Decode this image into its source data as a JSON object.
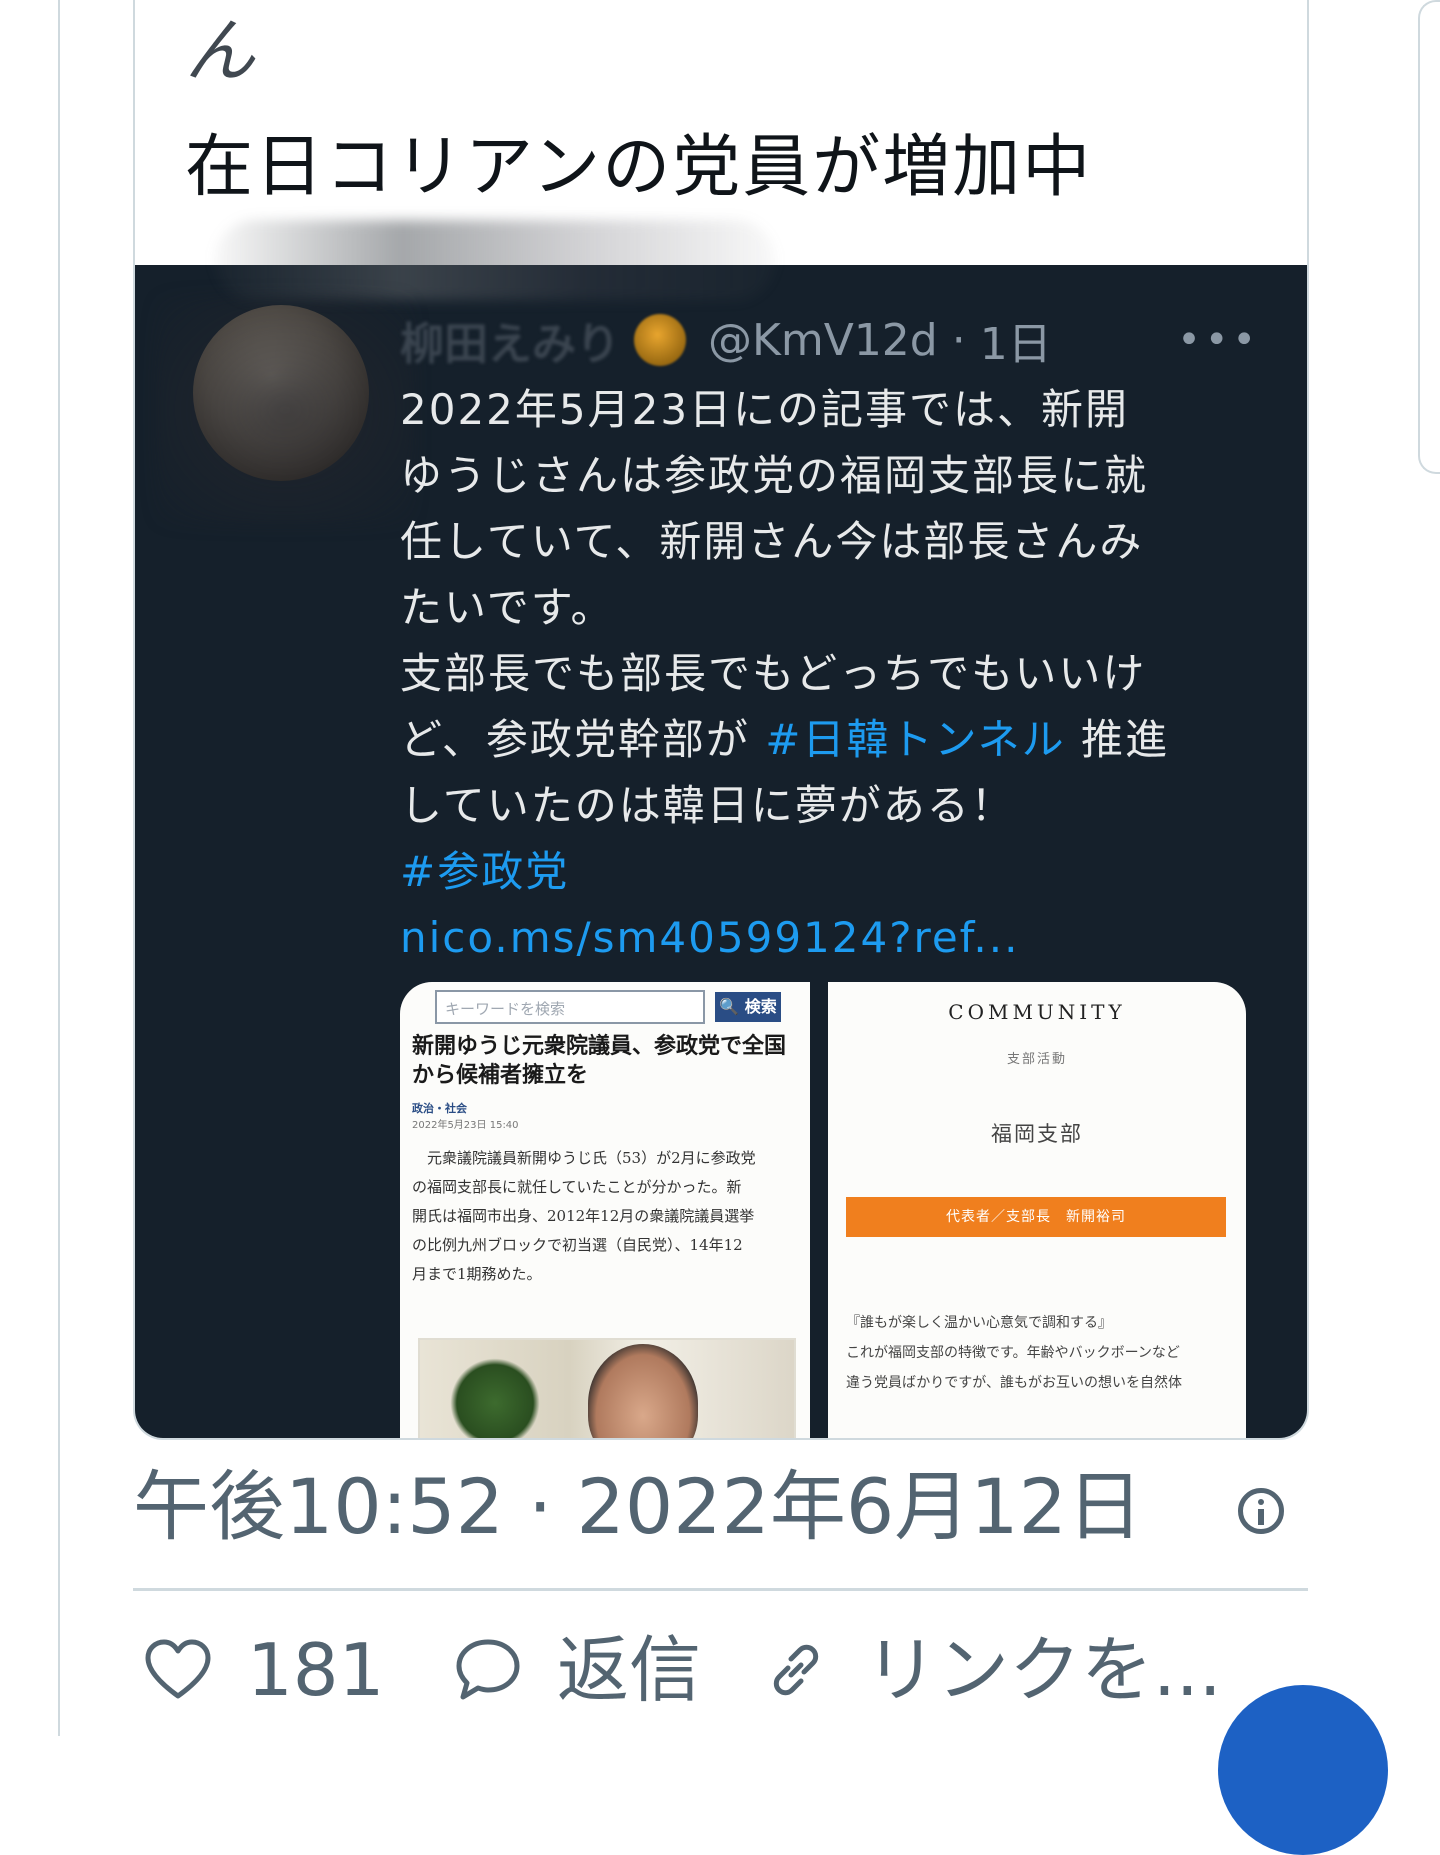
{
  "tweet": {
    "truncated_prev_line": "ん",
    "headline": "在日コリアンの党員が増加中"
  },
  "quoted_screenshot": {
    "author_name": "柳田えみり",
    "handle": "@KmV12d",
    "age": "1日",
    "more_icon": "more-horizontal-icon",
    "body_lines": [
      "2022年5月23日にの記事では、新開",
      "ゆうじさんは参政党の福岡支部長に就",
      "任していて、新開さん今は部長さんみ",
      "たいです。",
      "支部長でも部長でもどっちでもいいけ"
    ],
    "line6_prefix": "ど、参政党幹部が ",
    "hashtag1": "#日韓トンネル",
    "line6_suffix": " 推進",
    "line7": "していたのは韓日に夢がある！",
    "hashtag2": "#参政党",
    "link": "nico.ms/sm40599124?ref...",
    "article": {
      "search_placeholder": "キーワードを検索",
      "search_button": "🔍 検索",
      "title": "新開ゆうじ元衆院議員、参政党で全国から候補者擁立を",
      "category": "政治・社会",
      "date": "2022年5月23日 15:40",
      "body_lines": [
        "　元衆議院議員新開ゆうじ氏（53）が2月に参政党",
        "の福岡支部長に就任していたことが分かった。新",
        "開氏は福岡市出身、2012年12月の衆議院議員選挙",
        "の比例九州ブロックで初当選（自民党）、14年12",
        "月まで1期務めた。"
      ]
    },
    "community": {
      "title": "COMMUNITY",
      "subtitle": "支部活動",
      "branch": "福岡支部",
      "representative": "代表者／支部長　新開裕司",
      "desc_lines": [
        "『誰もが楽しく温かい心意気で調和する』",
        "これが福岡支部の特徴です。年齢やバックボーンなど",
        "違う党員ばかりですが、誰もがお互いの想いを自然体"
      ]
    }
  },
  "timestamp": "午後10:52 · 2022年6月12日",
  "info_icon": "info-icon",
  "actions": {
    "like_icon": "heart-icon",
    "like_count": "181",
    "reply_icon": "speech-bubble-icon",
    "reply_label": "返信",
    "link_icon": "link-icon",
    "link_label": "リンクを..."
  },
  "colors": {
    "dark_bg": "#15202b",
    "hashtag_blue": "#1d9bf0",
    "secondary_text": "#536471",
    "community_orange": "#f07f1e"
  }
}
